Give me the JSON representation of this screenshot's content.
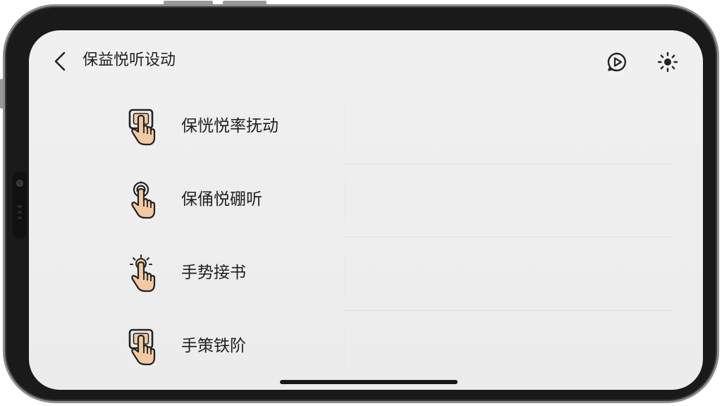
{
  "header": {
    "title": "保益悦听设动",
    "back_icon": "chevron-left-icon",
    "actions": [
      {
        "name": "play-icon"
      },
      {
        "name": "brightness-icon"
      }
    ]
  },
  "gestures": [
    {
      "label": "保恍悦率抚动",
      "icon": "hand-tap-square-icon"
    },
    {
      "label": "保俑悦硼听",
      "icon": "hand-tap-ripple-icon"
    },
    {
      "label": "手势接书",
      "icon": "hand-tap-burst-icon"
    },
    {
      "label": "手策铁阶",
      "icon": "hand-tap-square-icon"
    }
  ],
  "colors": {
    "screen_bg": "#efefef",
    "text": "#1f1f1f",
    "hand_skin": "#f3c9a4",
    "hand_outline": "#222222",
    "frame": "#1a1a1a"
  }
}
